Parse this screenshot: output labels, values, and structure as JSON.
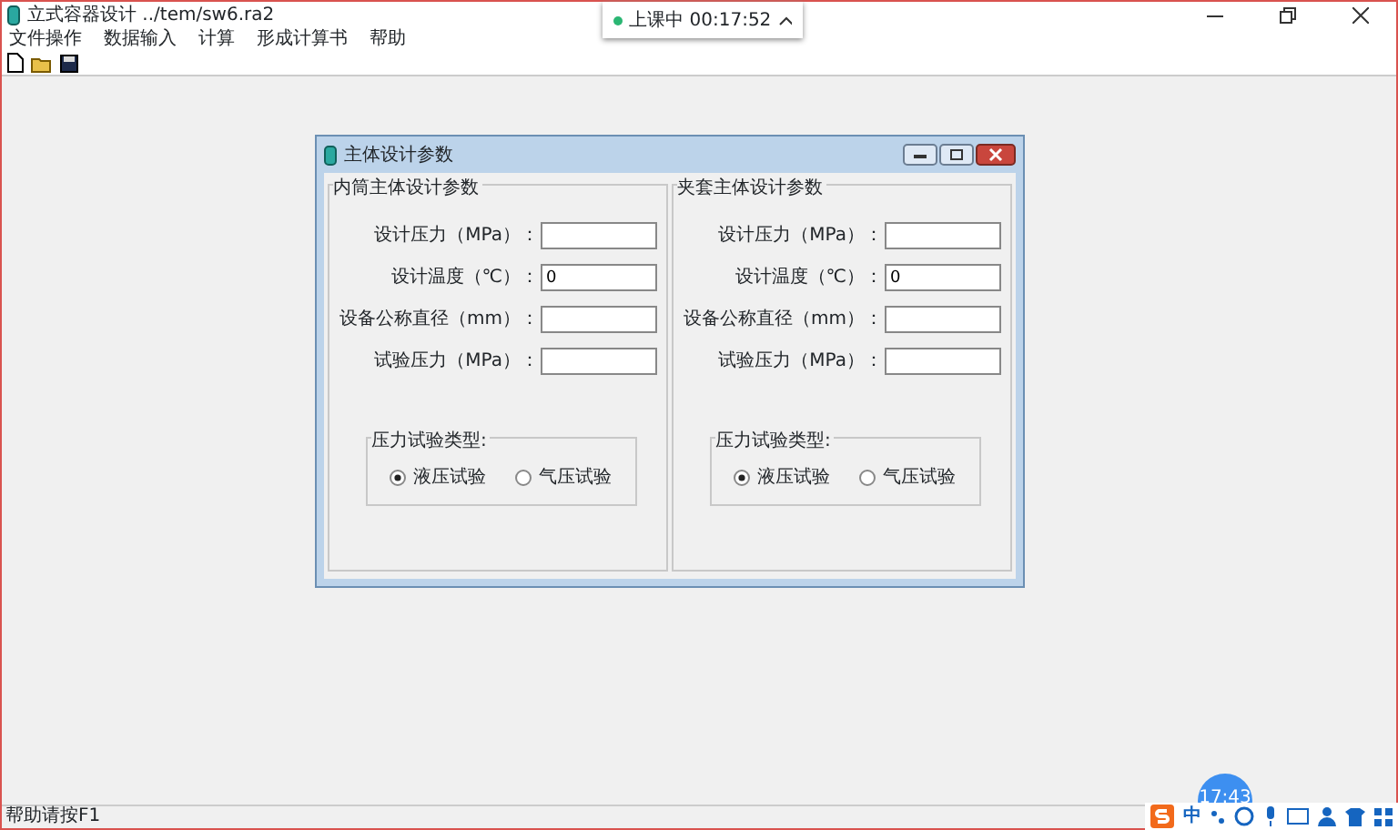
{
  "window": {
    "title": "立式容器设计 ../tem/sw6.ra2"
  },
  "menu": [
    "文件操作",
    "数据输入",
    "计算",
    "形成计算书",
    "帮助"
  ],
  "class_pill": {
    "status": "上课中 00:17:52"
  },
  "dialog": {
    "title": "主体设计参数",
    "panels": [
      {
        "title": "内筒主体设计参数",
        "fields": [
          {
            "label": "设计压力（MPa）："
          },
          {
            "label": "设计温度（℃）：",
            "value": "0"
          },
          {
            "label": "设备公称直径（mm）："
          },
          {
            "label": "试验压力（MPa）："
          }
        ],
        "radio_group": {
          "title": "压力试验类型:",
          "options": [
            {
              "label": "液压试验",
              "selected": true
            },
            {
              "label": "气压试验",
              "selected": false
            }
          ]
        }
      },
      {
        "title": "夹套主体设计参数",
        "fields": [
          {
            "label": "设计压力（MPa）："
          },
          {
            "label": "设计温度（℃）：",
            "value": "0"
          },
          {
            "label": "设备公称直径（mm）："
          },
          {
            "label": "试验压力（MPa）："
          }
        ],
        "radio_group": {
          "title": "压力试验类型:",
          "options": [
            {
              "label": "液压试验",
              "selected": true
            },
            {
              "label": "气压试验",
              "selected": false
            }
          ]
        }
      }
    ]
  },
  "status_bar": "帮助请按F1",
  "clock_bubble": "17:43",
  "ime": {
    "mode": "中"
  }
}
